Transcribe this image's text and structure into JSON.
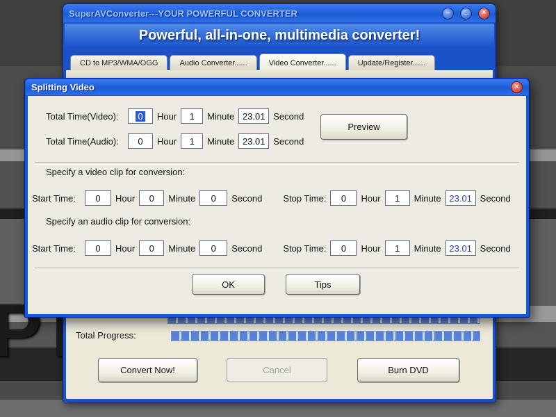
{
  "desktop": {
    "bg_text": "PT"
  },
  "icons": {
    "minimize": "–",
    "maximize": "□",
    "close": "✕"
  },
  "window": {
    "title": "SuperAVConverter---YOUR POWERFUL CONVERTER",
    "banner": "Powerful, all-in-one, multimedia converter!",
    "tabs": [
      {
        "label": "CD to MP3/WMA/OGG"
      },
      {
        "label": "Audio Converter......"
      },
      {
        "label": "Video Converter......"
      },
      {
        "label": "Update/Register......"
      }
    ],
    "total_progress_label": "Total Progress:",
    "buttons": {
      "convert": "Convert Now!",
      "cancel": "Cancel",
      "burn": "Burn DVD"
    }
  },
  "dialog": {
    "title": "Splitting Video",
    "units": {
      "hour": "Hour",
      "minute": "Minute",
      "second": "Second"
    },
    "labels": {
      "total_video": "Total Time(Video):",
      "total_audio": "Total Time(Audio):",
      "video_clip": "Specify a video clip for conversion:",
      "audio_clip": "Specify an audio clip for conversion:",
      "start": "Start Time:",
      "stop": "Stop Time:"
    },
    "values": {
      "total_video": {
        "hour": "0",
        "minute": "1",
        "second": "23.01"
      },
      "total_audio": {
        "hour": "0",
        "minute": "1",
        "second": "23.01"
      },
      "video_start": {
        "hour": "0",
        "minute": "0",
        "second": "0"
      },
      "video_stop": {
        "hour": "0",
        "minute": "1",
        "second": "23.01"
      },
      "audio_start": {
        "hour": "0",
        "minute": "0",
        "second": "0"
      },
      "audio_stop": {
        "hour": "0",
        "minute": "1",
        "second": "23.01"
      }
    },
    "buttons": {
      "preview": "Preview",
      "ok": "OK",
      "tips": "Tips"
    }
  }
}
